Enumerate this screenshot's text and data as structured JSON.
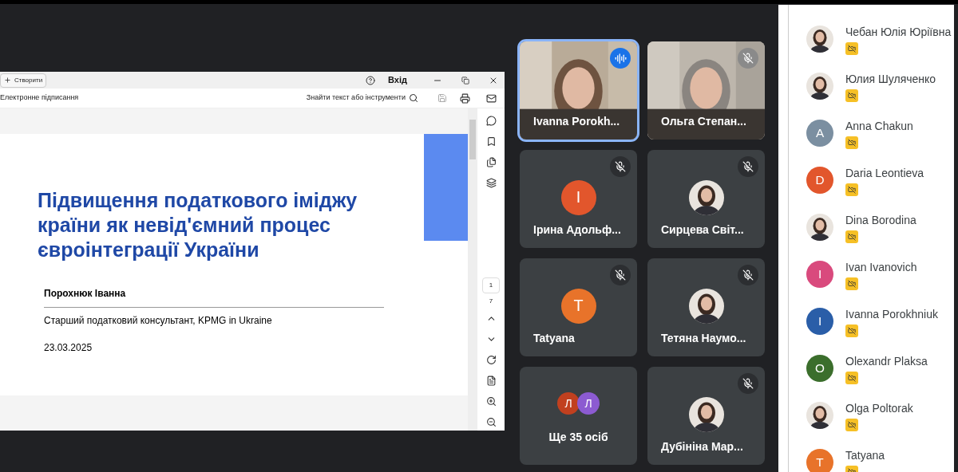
{
  "pdf_viewer": {
    "create_button": "Створити",
    "sign_in": "Вхід",
    "tab": "Електронне підписання",
    "search_hint": "Знайти текст або інструменти",
    "page_current": "1",
    "page_total": "7",
    "slide": {
      "title_lines": [
        "Підвищення податкового іміджу",
        "країни як невід'ємний процес",
        "євроінтеграції України"
      ],
      "author": "Порохнюк Іванна",
      "position": "Старший податковий консультант, KPMG in Ukraine",
      "date": "23.03.2025"
    }
  },
  "tiles": [
    {
      "kind": "video",
      "name": "Ivanna Porokh...",
      "speaking": true,
      "muted": false
    },
    {
      "kind": "video",
      "name": "Ольга Степан...",
      "speaking": false,
      "muted": true
    },
    {
      "kind": "letter",
      "name": "Ірина Адольф...",
      "initial": "I",
      "color": "#e2562c",
      "speaking": false,
      "muted": true
    },
    {
      "name": "Сирцева Світ...",
      "speaking": false,
      "muted": true
    },
    {
      "kind": "letter",
      "name": "Tatyana",
      "initial": "T",
      "color": "#e8732a",
      "speaking": false,
      "muted": true
    },
    {
      "name": "Тетяна Наумо...",
      "speaking": false,
      "muted": true
    },
    {
      "kind": "more",
      "name": "Ще 35 осіб",
      "speaking": false,
      "muted": false,
      "initials": [
        {
          "initial": "Л",
          "color": "#c1401f"
        },
        {
          "initial": "Л",
          "color": "#8c5bd1"
        }
      ]
    },
    {
      "name": "Дубініна Мар...",
      "speaking": false,
      "muted": true
    }
  ],
  "participants": [
    {
      "name": "Чебан Юлія Юріївна"
    },
    {
      "name": "Юлия Шуляченко"
    },
    {
      "kind": "letter",
      "name": "Anna Chakun",
      "initial": "A",
      "color": "#7b8fa1"
    },
    {
      "kind": "letter",
      "name": "Daria Leontieva",
      "initial": "D",
      "color": "#e2562c"
    },
    {
      "name": "Dina Borodina"
    },
    {
      "kind": "letter",
      "name": "Ivan Ivanovich",
      "initial": "I",
      "color": "#d94a7d"
    },
    {
      "kind": "letter",
      "name": "Ivanna Porokhniuk",
      "initial": "I",
      "color": "#2a5ea8"
    },
    {
      "kind": "letter",
      "name": "Olexandr Plaksa",
      "initial": "O",
      "color": "#3b6e2c"
    },
    {
      "name": "Olga Poltorak"
    },
    {
      "kind": "letter",
      "name": "Tatyana",
      "initial": "T",
      "color": "#e8732a"
    }
  ]
}
